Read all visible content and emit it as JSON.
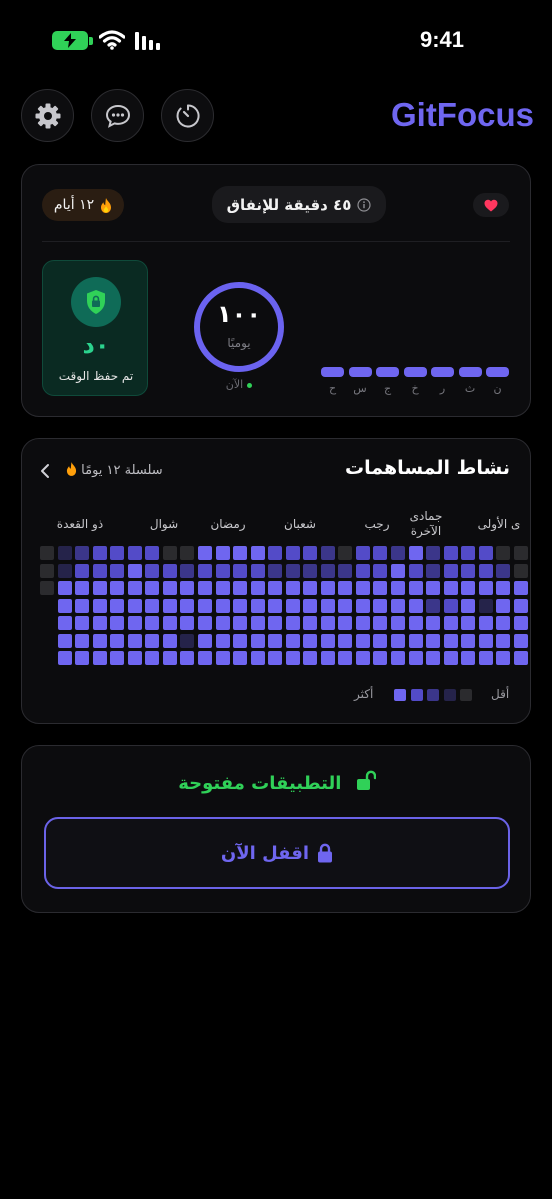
{
  "status_bar": {
    "time": "9:41"
  },
  "header": {
    "app_title": "GitFocus",
    "buttons": [
      {
        "name": "settings-button",
        "icon": "gear-icon"
      },
      {
        "name": "chat-button",
        "icon": "chat-bubble-icon"
      },
      {
        "name": "timer-button",
        "icon": "timer-icon"
      }
    ]
  },
  "focus": {
    "streak_label": "١٢ أيام",
    "budget_label": "٤٥ دقيقة للإنفاق",
    "saved_value": "٠د",
    "saved_label": "تم حفظ الوقت",
    "daily_value": "١٠٠",
    "daily_unit": "يوميًا",
    "now_label": "الآن",
    "week": [
      {
        "day": "ن",
        "progress": 1
      },
      {
        "day": "ث",
        "progress": 1
      },
      {
        "day": "ر",
        "progress": 1
      },
      {
        "day": "خ",
        "progress": 1
      },
      {
        "day": "ج",
        "progress": 1
      },
      {
        "day": "س",
        "progress": 1
      },
      {
        "day": "ح",
        "progress": 1
      }
    ]
  },
  "contributions": {
    "title": "نشاط المساهمات",
    "streak_label": "سلسلة ١٢ يومًا",
    "months": [
      "ى الأولى",
      "جمادى\nالآخرة",
      "رجب",
      "شعبان",
      "رمضان",
      "شوال",
      "ذو القعدة"
    ],
    "legend_less": "أقل",
    "legend_more": "أكثر",
    "grid": [
      "0123333004444333203324233300",
      "0133343323333222223343233320",
      "0444444444444444444444444444",
      " 444444444444444444444234144",
      " 444444444444444444444444444",
      " 444444414444444444444444444",
      " 444444444444444444444444444"
    ]
  },
  "apps": {
    "status_label": "التطبيقات مفتوحة",
    "lock_button_label": "اقفل الآن"
  },
  "colors": {
    "accent": "#6f66f0",
    "green": "#30d158",
    "level_0": "#2b2b2e",
    "level_1": "#25234a",
    "level_2": "#3b368a",
    "level_3": "#534bc8",
    "level_4": "#6f66f0"
  }
}
